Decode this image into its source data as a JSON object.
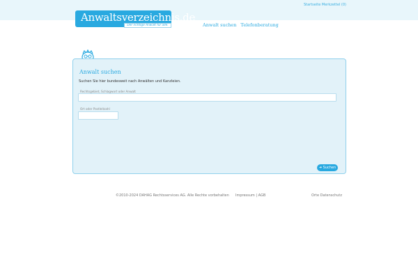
{
  "header": {
    "links": [
      "Startseite",
      "Merkzettel (0)"
    ]
  },
  "logo": {
    "text": "Anwaltsverzeichnis.de",
    "tagline": "Der richtige Anwalt für alle."
  },
  "nav": {
    "items": [
      "Anwalt suchen",
      "Telefonberatung"
    ]
  },
  "search_panel": {
    "title": "Anwalt suchen",
    "description": "Suchen Sie hier bundesweit nach Anwälten und Kanzleien.",
    "query_label": "Rechtsgebiet, Schlagwort oder Anwalt",
    "query_value": "",
    "location_label": "Ort oder Postleitzahl",
    "location_value": "",
    "button_label": "Suchen",
    "button_icon": "arrow-right-icon"
  },
  "footer": {
    "copyright": "©2010-2024 DAHAG Rechtsservices AG. Alle Rechte vorbehalten",
    "impressum": "Impressum",
    "separator": "|",
    "agb": "AGB",
    "orte": "Orte",
    "datenschutz": "Datenschutz"
  },
  "colors": {
    "accent": "#29a9e0",
    "panel_bg": "#e2f2f9",
    "top_band": "#e8f6fb"
  }
}
